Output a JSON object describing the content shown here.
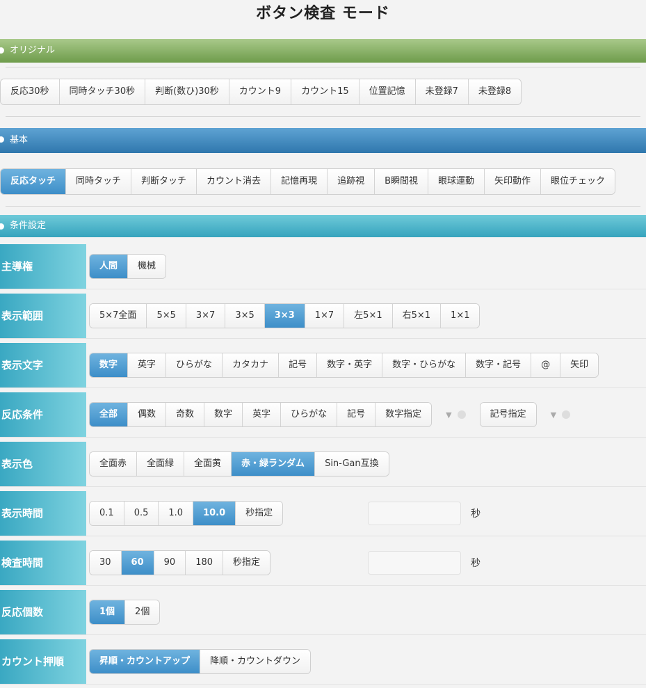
{
  "title": "ボタン検査 モード",
  "sections": {
    "original": {
      "header": "オリジナル",
      "buttons": [
        "反応30秒",
        "同時タッチ30秒",
        "判断(数ひ)30秒",
        "カウント9",
        "カウント15",
        "位置記憶",
        "未登録7",
        "未登録8"
      ]
    },
    "basic": {
      "header": "基本",
      "buttons": [
        "反応タッチ",
        "同時タッチ",
        "判断タッチ",
        "カウント消去",
        "記憶再現",
        "追跡視",
        "B瞬間視",
        "眼球運動",
        "矢印動作",
        "眼位チェック"
      ],
      "active": "反応タッチ"
    },
    "conditions": {
      "header": "条件設定",
      "rows": {
        "leader": {
          "label": "主導権",
          "options": [
            "人間",
            "機械"
          ],
          "active": "人間"
        },
        "range": {
          "label": "表示範囲",
          "options": [
            "5×7全面",
            "5×5",
            "3×7",
            "3×5",
            "3×3",
            "1×7",
            "左5×1",
            "右5×1",
            "1×1"
          ],
          "active": "3×3"
        },
        "chars": {
          "label": "表示文字",
          "options": [
            "数字",
            "英字",
            "ひらがな",
            "カタカナ",
            "記号",
            "数字・英字",
            "数字・ひらがな",
            "数字・記号",
            "@",
            "矢印"
          ],
          "active": "数字"
        },
        "reaction": {
          "label": "反応条件",
          "options": [
            "全部",
            "偶数",
            "奇数",
            "数字",
            "英字",
            "ひらがな",
            "記号",
            "数字指定"
          ],
          "active": "全部",
          "symbol_option": "記号指定",
          "select_caret": "▼"
        },
        "color": {
          "label": "表示色",
          "options": [
            "全面赤",
            "全面緑",
            "全面黄",
            "赤・緑ランダム",
            "Sin-Gan互換"
          ],
          "active": "赤・緑ランダム"
        },
        "display_time": {
          "label": "表示時間",
          "options": [
            "0.1",
            "0.5",
            "1.0",
            "10.0",
            "秒指定"
          ],
          "active": "10.0",
          "input_value": "",
          "unit": "秒"
        },
        "test_time": {
          "label": "検査時間",
          "options": [
            "30",
            "60",
            "90",
            "180",
            "秒指定"
          ],
          "active": "60",
          "input_value": "",
          "unit": "秒"
        },
        "count": {
          "label": "反応個数",
          "options": [
            "1個",
            "2個"
          ],
          "active": "1個"
        },
        "order": {
          "label": "カウント押順",
          "options": [
            "昇順・カウントアップ",
            "降順・カウントダウン"
          ],
          "active": "昇順・カウントアップ"
        }
      }
    }
  },
  "colors": {
    "green_header": "#6e9c4b",
    "blue_header": "#2f77ad",
    "teal_header": "#35a3bd",
    "active_button": "#3d8ec8"
  }
}
